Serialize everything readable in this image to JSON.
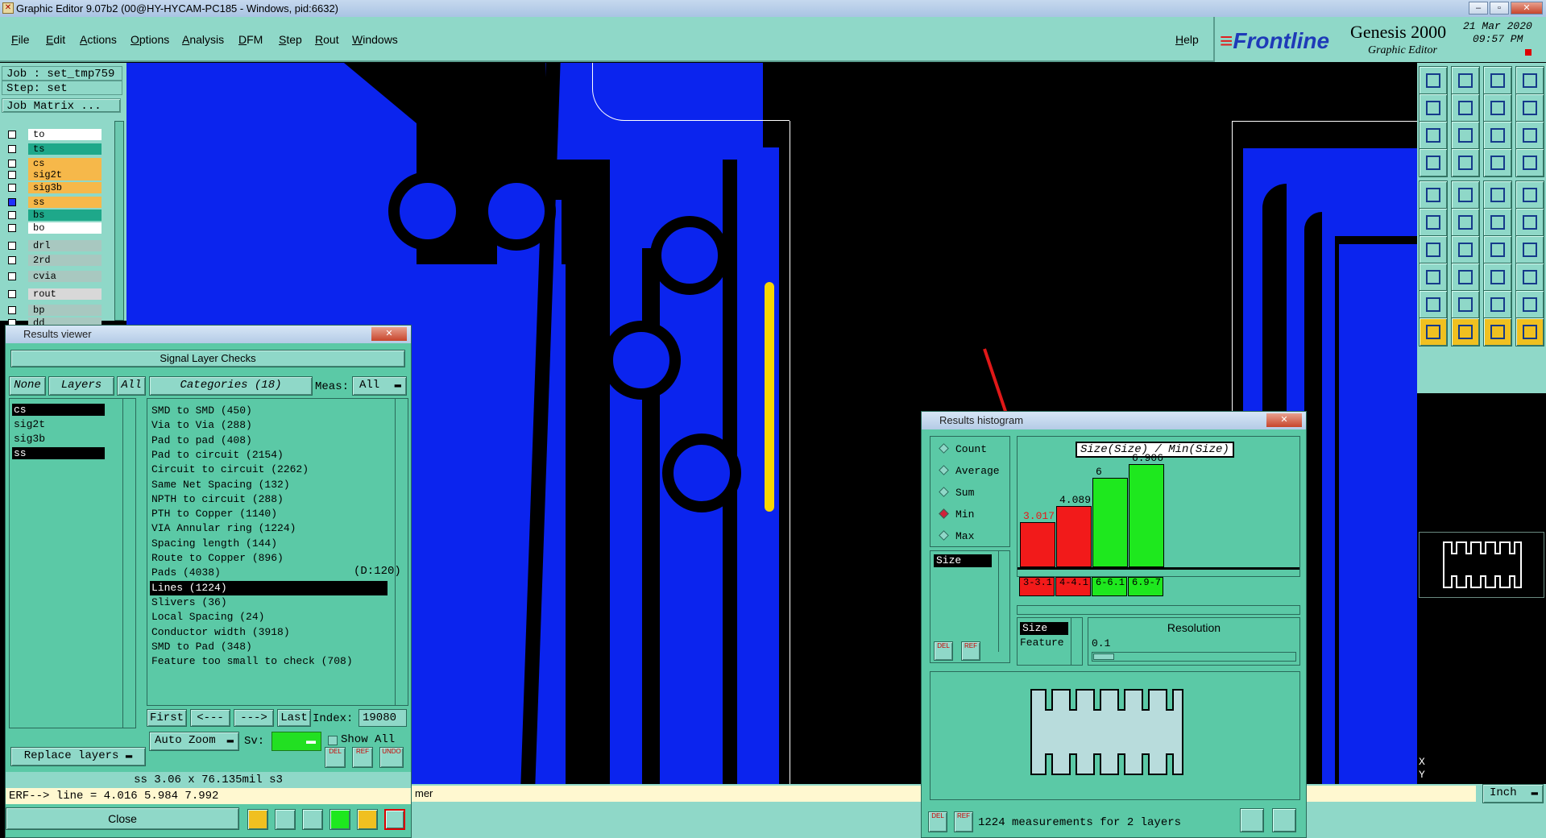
{
  "window": {
    "title": "Graphic Editor 9.07b2 (00@HY-HYCAM-PC185 - Windows, pid:6632)"
  },
  "menu": [
    "File",
    "Edit",
    "Actions",
    "Options",
    "Analysis",
    "DFM",
    "Step",
    "Rout",
    "Windows"
  ],
  "help": "Help",
  "brand": {
    "logo": "Frontline",
    "product": "Genesis 2000",
    "subtitle": "Graphic Editor",
    "date": "21 Mar 2020",
    "time": "09:57 PM"
  },
  "job": {
    "job": "Job : set_tmp759",
    "step": "Step: set",
    "matrix": "Job Matrix ..."
  },
  "layers": [
    {
      "name": "to",
      "color": "#ffffff"
    },
    {
      "name": "ts",
      "color": "#1ea88a"
    },
    {
      "name": "cs",
      "color": "#f6b84a"
    },
    {
      "name": "sig2t",
      "color": "#f6b84a"
    },
    {
      "name": "sig3b",
      "color": "#f6b84a"
    },
    {
      "name": "ss",
      "color": "#f6b84a"
    },
    {
      "name": "bs",
      "color": "#1ea88a"
    },
    {
      "name": "bo",
      "color": "#ffffff"
    },
    {
      "name": "drl",
      "color": "#a8c8c0"
    },
    {
      "name": "2rd",
      "color": "#a8c8c0"
    },
    {
      "name": "cvia",
      "color": "#a8c8c0"
    },
    {
      "name": "rout",
      "color": "#d8d8d8"
    },
    {
      "name": "bp",
      "color": "#a8c8c0"
    },
    {
      "name": "dd",
      "color": "#a8c8c0"
    }
  ],
  "results_viewer": {
    "title": "Results viewer",
    "check": "Signal Layer Checks",
    "none": "None",
    "layers_label": "Layers",
    "all": "All",
    "categories_label": "Categories (18)",
    "meas_label": "Meas:",
    "meas_value": "All",
    "layer_list": [
      "cs",
      "sig2t",
      "sig3b",
      "ss"
    ],
    "categories": [
      "SMD to SMD (450)",
      "Via to Via (288)",
      "Pad to pad (408)",
      "Pad to circuit (2154)",
      "Circuit to circuit (2262)",
      "Same Net Spacing (132)",
      "NPTH to circuit (288)",
      "PTH to Copper (1140)",
      "VIA Annular ring (1224)",
      "Spacing length (144)",
      "Route to Copper (896)",
      "Pads (4038)",
      "Lines (1224)",
      "Slivers (36)",
      "Local Spacing (24)",
      "Conductor width (3918)",
      "SMD to Pad (348)",
      "Feature too small to check (708)"
    ],
    "route_extra": "(D:120)",
    "nav": {
      "first": "First",
      "prev": "<---",
      "next": "--->",
      "last": "Last",
      "index_label": "Index:",
      "index_value": "19080"
    },
    "auto_zoom": "Auto Zoom",
    "sv_label": "Sv:",
    "show_all": "Show All",
    "replace_layers": "Replace layers",
    "del": "DEL",
    "ref": "REF",
    "undo": "UNDO",
    "status": "ss 3.06 x 76.135mil  s3",
    "erf": "ERF--> line = 4.016 5.984 7.992",
    "close": "Close"
  },
  "histogram": {
    "title": "Results histogram",
    "chart_title": "Size(Size) / Min(Size)",
    "options": [
      "Count",
      "Average",
      "Sum",
      "Min",
      "Max"
    ],
    "selected": "Min",
    "list_item": "Size",
    "size": "Size",
    "feature": "Feature",
    "resolution_label": "Resolution",
    "resolution_value": "0.1",
    "summary": "1224 measurements for 2 layers",
    "del": "DEL",
    "ref": "REF"
  },
  "chart_data": {
    "type": "bar",
    "title": "Size(Size) / Min(Size)",
    "categories": [
      "3-3.1",
      "4-4.1",
      "6-6.1",
      "6.9-7"
    ],
    "values": [
      3.017,
      4.089,
      6,
      6.906
    ],
    "labels": [
      "3.017",
      "4.089",
      "6",
      "6.906"
    ],
    "colors": [
      "#f21a1a",
      "#f21a1a",
      "#1ee81e",
      "#1ee81e"
    ],
    "ylim": [
      0,
      7
    ]
  },
  "bottom": {
    "msg": "mer",
    "units": "Inch",
    "coord_x": "X",
    "coord_y": "Y"
  },
  "colors": {
    "copper": "#0b24ee",
    "panel": "#5bc9a6",
    "highlight": "#f7d600",
    "pass": "#1ee81e",
    "fail": "#f21a1a"
  }
}
